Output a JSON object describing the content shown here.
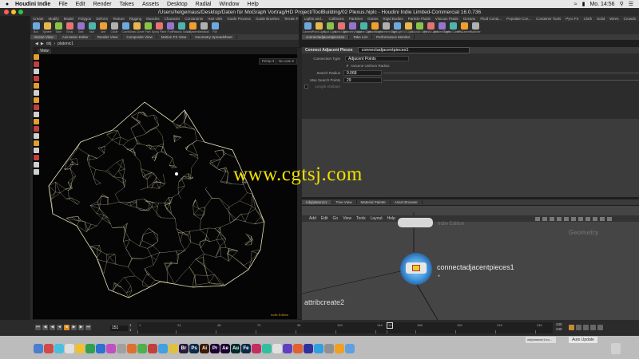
{
  "menubar": {
    "apple": "",
    "app": "Houdini Indie",
    "items": [
      "File",
      "Edit",
      "Render",
      "Takes",
      "Assets",
      "Desktop",
      "Radial",
      "Window",
      "Help"
    ],
    "clock": "Mo. 14:56"
  },
  "titlebar": {
    "title": "/Users/helgemaus/Desktop/Daten für MoGraph Vortrag/HD Project/ToolBuilding/02 Plexus.hiplc - Houdini Indie Limited-Commercial 16.0.736"
  },
  "shelf_left": {
    "tabs": [
      "Create",
      "Modify",
      "Model",
      "Polygon",
      "Deform",
      "Texture",
      "Rigging",
      "Muscles",
      "Character",
      "Constraints",
      "Hair Utils",
      "Guide Process",
      "Guide Brushes",
      "Terrain FX",
      "Cloud FX",
      "Volume"
    ],
    "tools": [
      "Box",
      "Sphere",
      "Tube",
      "Torus",
      "Grid",
      "Null",
      "Line",
      "Circle",
      "Curve",
      "Draw Curve",
      "Path",
      "Spray Paint",
      "Font",
      "Platonic Solids",
      "L-System",
      "Metaball",
      "File"
    ]
  },
  "shelf_right": {
    "tabs": [
      "Lights and...",
      "Collisions",
      "Particles",
      "Grains",
      "Rigid Bodies",
      "Particle Fluids",
      "Viscous Fluids",
      "Oceans",
      "Fluid Conta...",
      "Populate Con...",
      "Container Tools",
      "Pyro FX",
      "Cloth",
      "Solid",
      "Wires",
      "Crowds",
      "Drive Simula..."
    ],
    "tools": [
      "Camera",
      "Point Light",
      "Spot Light",
      "Area Light",
      "Geometry Light",
      "Volume Light",
      "Distant Light",
      "Environment Light",
      "Sky Light",
      "GI Light",
      "Caustic Light",
      "Portal Light",
      "Ambient Light",
      "Stereo Camera",
      "VR Camera",
      "Switcher"
    ]
  },
  "pane_tabs_left": [
    "Scene View",
    "Animation Editor",
    "Render View",
    "Composite View",
    "Motion FX View",
    "Geometry Spreadsheet"
  ],
  "pane_tabs_right": [
    "connectadjacentpieces1",
    "Take List",
    "Performance Monitor"
  ],
  "viewport": {
    "path_obj": "obj",
    "path_geo": "platonic1",
    "view_label": "View",
    "persp_menu": "Persp ▾",
    "cam_menu": "No cam ▾",
    "edition": "Indie Edition"
  },
  "params": {
    "node_type": "Connect Adjacent Pieces",
    "node_name": "connectadjacentpieces1",
    "connection_type_label": "Connection Type",
    "connection_type_value": "Adjacent Points",
    "uniform_radius_label": "Assume Uniform Radius",
    "search_radius_label": "Search Radius",
    "search_radius_value": "0.068",
    "max_search_points_label": "Max Search Points",
    "max_search_points_value": "29",
    "length_attr_label": "Length Attribute"
  },
  "net_top": {
    "path_obj": "obj",
    "path_geo": "platonic1"
  },
  "net_bottom": {
    "tabs": [
      "/obj/platonic1",
      "Tree View",
      "Material Palette",
      "Asset Browser"
    ],
    "path_obj": "obj",
    "path_geo": "platonic1",
    "menu": [
      "Add",
      "Edit",
      "Go",
      "View",
      "Tools",
      "Layout",
      "Help"
    ],
    "context_label": "Geometry",
    "node_label": "connectadjacentpieces1",
    "attrib_label": "attribcreate2",
    "upper_node_label": "Indie Edition"
  },
  "timeline": {
    "frame": "151",
    "ticks": [
      "1",
      "24",
      "48",
      "72",
      "96",
      "120",
      "144",
      "151",
      "168",
      "192",
      "216",
      "240"
    ],
    "range_end_top": "240",
    "range_end_bottom": "240",
    "start_field": "1",
    "start_field2": "1"
  },
  "dock": {
    "window_title": "obj/platonic1/co...",
    "update_label": "Auto Update",
    "app_letters": [
      "Br",
      "Ps",
      "Ai",
      "Pr",
      "Ae",
      "Au",
      "Fe"
    ]
  },
  "watermark": "www.cgtsj.com",
  "colors": {
    "accent": "#e08a1a",
    "wire": "#e8e2b8",
    "node_blue": "#4aa0e0",
    "watermark": "#f0e000"
  }
}
